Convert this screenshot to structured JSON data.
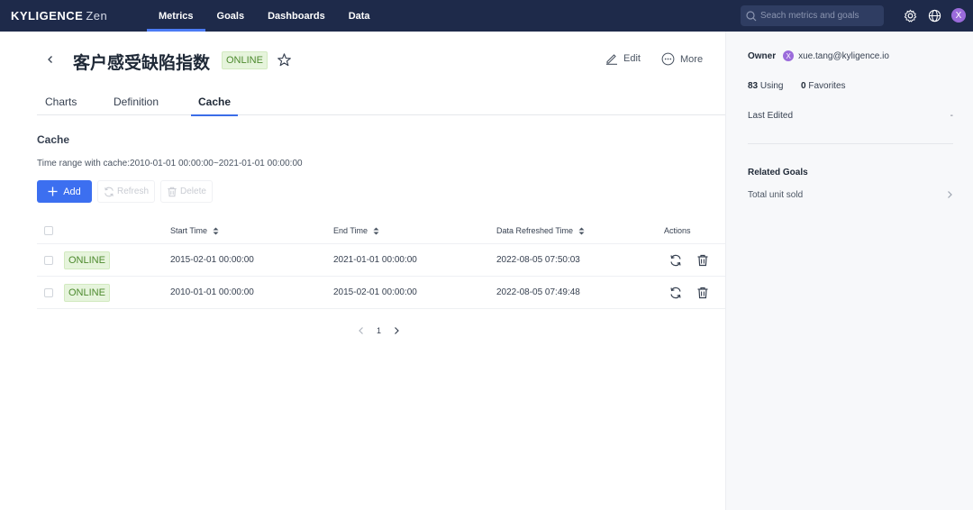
{
  "app": {
    "logo_main": "KYLIGENCE",
    "logo_sub": "Zen",
    "nav": [
      {
        "label": "Metrics",
        "active": true
      },
      {
        "label": "Goals"
      },
      {
        "label": "Dashboards"
      },
      {
        "label": "Data"
      }
    ],
    "search_placeholder": "Seach metrics and goals",
    "user_initial": "X"
  },
  "metric": {
    "title": "客户感受缺陷指数",
    "status": "ONLINE",
    "edit_label": "Edit",
    "more_label": "More"
  },
  "tabs": [
    {
      "label": "Charts"
    },
    {
      "label": "Definition"
    },
    {
      "label": "Cache",
      "active": true
    }
  ],
  "cache": {
    "section_title": "Cache",
    "time_range": "Time range with cache:2010-01-01 00:00:00~2021-01-01 00:00:00",
    "add_label": "Add",
    "refresh_label": "Refresh",
    "delete_label": "Delete",
    "columns": {
      "start": "Start Time",
      "end": "End Time",
      "refreshed": "Data Refreshed Time",
      "actions": "Actions"
    },
    "rows": [
      {
        "status": "ONLINE",
        "start": "2015-02-01 00:00:00",
        "end": "2021-01-01 00:00:00",
        "refreshed": "2022-08-05 07:50:03"
      },
      {
        "status": "ONLINE",
        "start": "2010-01-01 00:00:00",
        "end": "2015-02-01 00:00:00",
        "refreshed": "2022-08-05 07:49:48"
      }
    ],
    "page": "1"
  },
  "panel": {
    "owner_label": "Owner",
    "owner_initial": "X",
    "owner_email": "xue.tang@kyligence.io",
    "using_count": "83",
    "using_label": "Using",
    "favorites_count": "0",
    "favorites_label": "Favorites",
    "last_edited_label": "Last Edited",
    "last_edited_value": "-",
    "related_goals_title": "Related Goals",
    "related_goals": [
      {
        "label": "Total unit sold"
      }
    ]
  },
  "colors": {
    "topbar": "#1e2a4a",
    "primary": "#3c6ff0",
    "online_bg": "#e6f4dc",
    "online_text": "#4d8a2e",
    "avatar": "#9b6bdb"
  }
}
